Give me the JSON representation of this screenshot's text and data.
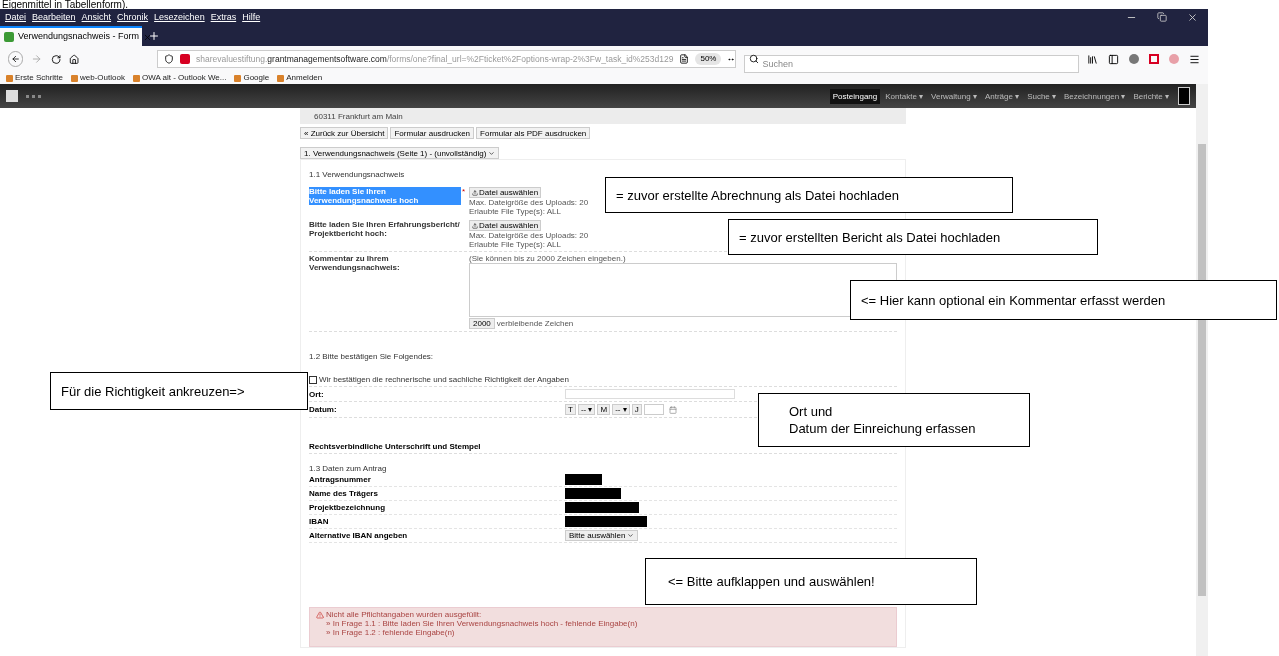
{
  "caption": "Eigenmittel in Tabellenform).",
  "menu": [
    "Datei",
    "Bearbeiten",
    "Ansicht",
    "Chronik",
    "Lesezeichen",
    "Extras",
    "Hilfe"
  ],
  "tabs": [
    {
      "title": "Verwendungsnachweis - Form",
      "selected": true
    }
  ],
  "address": {
    "host_pre": "sharevaluestiftung.",
    "host": "grantmanagementsoftware.com",
    "path": "/forms/one?final_url=%2Fticket%2Foptions-wrap-2%3Fw_task_id%253d129",
    "zoom": "50%"
  },
  "search": {
    "placeholder": "Suchen"
  },
  "bookmarks": [
    "Erste Schritte",
    "web-Outlook",
    "OWA alt - Outlook We...",
    "Google",
    "Anmelden"
  ],
  "app_nav": [
    {
      "label": "Posteingang",
      "selected": true
    },
    {
      "label": "Kontakte ▾",
      "selected": false
    },
    {
      "label": "Verwaltung ▾",
      "selected": false
    },
    {
      "label": "Anträge ▾",
      "selected": false
    },
    {
      "label": "Suche ▾",
      "selected": false
    },
    {
      "label": "Bezeichnungen ▾",
      "selected": false
    },
    {
      "label": "Berichte ▾",
      "selected": false
    }
  ],
  "address_card": "60311 Frankfurt am Main",
  "actions": [
    "« Zurück zur Übersicht",
    "Formular ausdrucken",
    "Formular als PDF ausdrucken"
  ],
  "page_select": "1. Verwendungsnachweis (Seite 1) - (unvollständig)",
  "section1": {
    "title": "1.1 Verwendungsnachweis",
    "uploads": [
      {
        "label": "Bitte laden Sie Ihren Verwendungsnachweis hoch",
        "highlighted": true,
        "required": "*",
        "button": "Datei auswählen",
        "hints": [
          "Max. Dateigröße des Uploads: 20",
          "Erlaubte File Type(s): ALL"
        ]
      },
      {
        "label": "Bitte laden Sie Ihren Erfahrungsbericht/ Projektbericht hoch:",
        "highlighted": false,
        "button": "Datei auswählen",
        "hints": [
          "Max. Dateigröße des Uploads: 20",
          "Erlaubte File Type(s): ALL"
        ]
      }
    ],
    "comment": {
      "label": "Kommentar zu Ihrem Verwendungsnachweis:",
      "hint": "(Sie können bis zu 2000 Zeichen eingeben.)",
      "count": "2000",
      "count_label": "verbleibende Zeichen"
    }
  },
  "section2": {
    "title": "1.2 Bitte bestätigen Sie Folgendes:",
    "confirm": {
      "label": "Wir bestätigen die rechnerische und sachliche Richtigkeit der Angaben",
      "checked": false
    },
    "place_label": "Ort:",
    "date_label": "Datum:",
    "date_parts": [
      "T",
      "-- ▾",
      "M",
      "-- ▾",
      "J"
    ],
    "signature": "Rechtsverbindliche Unterschrift und Stempel"
  },
  "section3": {
    "title": "1.3 Daten zum Antrag",
    "rows": [
      {
        "label": "Antragsnummer",
        "kind": "redacted"
      },
      {
        "label": "Name des Trägers",
        "kind": "redacted"
      },
      {
        "label": "Projektbezeichnung",
        "kind": "redacted"
      },
      {
        "label": "IBAN",
        "kind": "redacted"
      },
      {
        "label": "Alternative IBAN angeben",
        "kind": "select",
        "value": "Bitte auswählen"
      }
    ]
  },
  "alert": {
    "title": "Nicht alle Pflichtangaben wurden ausgefüllt:",
    "items": [
      "» In Frage 1.1 : Bitte laden Sie Ihren Verwendungsnachweis hoch - fehlende Eingabe(n)",
      "» In Frage 1.2 : fehlende Eingabe(n)"
    ]
  },
  "annotations": [
    {
      "lines": [
        "= zuvor erstellte Abrechnung als Datei hochladen"
      ]
    },
    {
      "lines": [
        "= zuvor erstellten Bericht als Datei hochladen"
      ]
    },
    {
      "lines": [
        "<= Hier kann optional ein Kommentar erfasst werden"
      ]
    },
    {
      "lines": [
        "Für die Richtigkeit ankreuzen=>"
      ]
    },
    {
      "lines": [
        "Ort und",
        "Datum der Einreichung erfassen"
      ]
    },
    {
      "lines": [
        "<= Bitte aufklappen und auswählen!"
      ]
    }
  ]
}
